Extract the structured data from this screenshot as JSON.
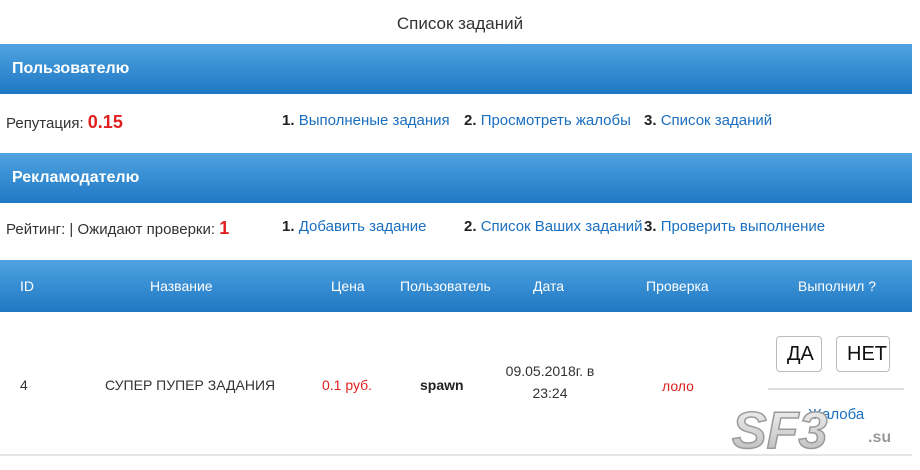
{
  "title": "Список заданий",
  "user_section": {
    "header": "Пользователю",
    "reputation_label": "Репутация:",
    "reputation_value": "0.15",
    "links": [
      {
        "num": "1.",
        "label": "Выполненые задания"
      },
      {
        "num": "2.",
        "label": "Просмотреть жалобы"
      },
      {
        "num": "3.",
        "label": "Список заданий"
      }
    ]
  },
  "advertiser_section": {
    "header": "Рекламодателю",
    "rating_label": "Рейтинг:",
    "pending_label": "| Ожидают проверки:",
    "pending_value": "1",
    "links": [
      {
        "num": "1.",
        "label": "Добавить задание"
      },
      {
        "num": "2.",
        "label": "Список Ваших заданий"
      },
      {
        "num": "3.",
        "label": "Проверить выполнение"
      }
    ]
  },
  "table": {
    "columns": [
      "ID",
      "Название",
      "Цена",
      "Пользователь",
      "Дата",
      "Проверка",
      "Выполнил ?"
    ],
    "rows": [
      {
        "id": "4",
        "name": "СУПЕР ПУПЕР ЗАДАНИЯ",
        "price": "0.1 руб.",
        "user": "spawn",
        "date_line1": "09.05.2018г. в",
        "date_line2": "23:24",
        "check": "лоло",
        "yes": "ДА",
        "no": "НЕТ",
        "complain": "Жалоба"
      }
    ]
  },
  "watermark": {
    "logo_text": "SF3",
    "logo_suffix": ".su"
  },
  "colors": {
    "bar": "#2b89d3",
    "accent_red": "#e02020",
    "link": "#1a6fc0"
  }
}
